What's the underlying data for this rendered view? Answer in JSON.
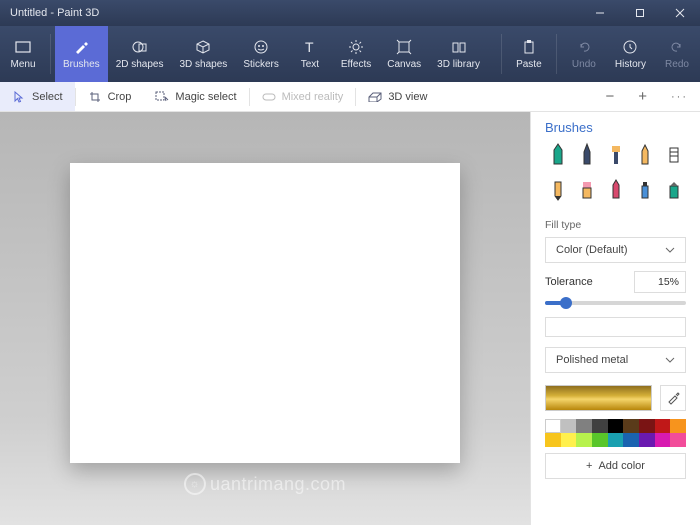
{
  "titlebar": {
    "title": "Untitled - Paint 3D"
  },
  "ribbon": {
    "menu": "Menu",
    "items": [
      {
        "label": "Brushes"
      },
      {
        "label": "2D shapes"
      },
      {
        "label": "3D shapes"
      },
      {
        "label": "Stickers"
      },
      {
        "label": "Text"
      },
      {
        "label": "Effects"
      },
      {
        "label": "Canvas"
      },
      {
        "label": "3D library"
      }
    ],
    "paste": "Paste",
    "undo": "Undo",
    "history": "History",
    "redo": "Redo"
  },
  "toolbar": {
    "select": "Select",
    "crop": "Crop",
    "magic": "Magic select",
    "mixed": "Mixed reality",
    "view3d": "3D view"
  },
  "panel": {
    "title": "Brushes",
    "fill_type_label": "Fill type",
    "fill_type_value": "Color (Default)",
    "tolerance_label": "Tolerance",
    "tolerance_value": "15%",
    "material_value": "Polished metal",
    "add_color": "Add color",
    "palette": [
      "#ffffff",
      "#c0c0c0",
      "#808080",
      "#404040",
      "#000000",
      "#5a3b1a",
      "#7a1414",
      "#c01818",
      "#f7941d",
      "#f7c51d",
      "#fff04d",
      "#b7f24d",
      "#59c62a",
      "#1aa0b0",
      "#1a63b0",
      "#6a1ab0",
      "#d81ab0",
      "#f24d9a"
    ]
  },
  "watermark": "uantrimang.com"
}
